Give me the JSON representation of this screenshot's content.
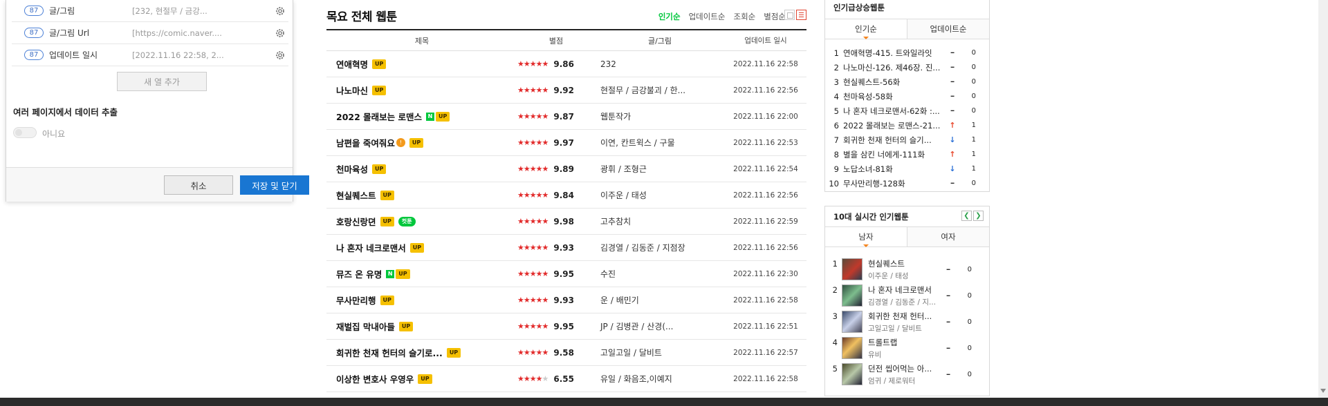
{
  "extract_panel": {
    "fields": [
      {
        "count": "87",
        "name": "글/그림",
        "sample": "[232, 현절무 / 금강..."
      },
      {
        "count": "87",
        "name": "글/그림 Url",
        "sample": "[https://comic.naver...."
      },
      {
        "count": "87",
        "name": "업데이트 일시",
        "sample": "[2022.11.16 22:58, 2..."
      }
    ],
    "add_column_label": "새 열 추가",
    "multi_page_title": "여러 페이지에서 데이터 추출",
    "multi_page_toggle_label": "아니요",
    "cancel_label": "취소",
    "save_label": "저장 및 닫기"
  },
  "webtoon_list": {
    "title": "목요 전체 웹툰",
    "sort_options": [
      "인기순",
      "업데이트순",
      "조회순",
      "별점순"
    ],
    "active_sort": "인기순",
    "headers": {
      "title": "제목",
      "rating": "별점",
      "author": "글/그림",
      "date": "업데이트 일시"
    },
    "rows": [
      {
        "title": "연애혁명",
        "badges": [
          "UP"
        ],
        "stars": 5,
        "rating": "9.86",
        "author": "232",
        "date": "2022.11.16 22:58"
      },
      {
        "title": "나노마신",
        "badges": [
          "UP"
        ],
        "stars": 5,
        "rating": "9.92",
        "author": "현절무 / 금강불괴 / 한...",
        "date": "2022.11.16 22:56"
      },
      {
        "title": "2022 몰래보는 로맨스",
        "badges": [
          "N",
          "UP"
        ],
        "stars": 5,
        "rating": "9.87",
        "author": "웹툰작가",
        "date": "2022.11.16 22:00"
      },
      {
        "title": "남편을 죽여줘요",
        "badges": [
          "AGE",
          "UP"
        ],
        "stars": 5,
        "rating": "9.97",
        "author": "이연, 칸트윅스 / 구물",
        "date": "2022.11.16 22:53"
      },
      {
        "title": "천마육성",
        "badges": [
          "UP"
        ],
        "stars": 5,
        "rating": "9.89",
        "author": "광휘 / 조형근",
        "date": "2022.11.16 22:54"
      },
      {
        "title": "현실퀘스트",
        "badges": [
          "UP"
        ],
        "stars": 5,
        "rating": "9.84",
        "author": "이주운 / 태성",
        "date": "2022.11.16 22:56"
      },
      {
        "title": "호랑신랑뎐",
        "badges": [
          "UP",
          "컷툰"
        ],
        "stars": 5,
        "rating": "9.98",
        "author": "고추참치",
        "date": "2022.11.16 22:59"
      },
      {
        "title": "나 혼자 네크로맨서",
        "badges": [
          "UP"
        ],
        "stars": 5,
        "rating": "9.93",
        "author": "김경열 / 김동준 / 지점장",
        "date": "2022.11.16 22:56"
      },
      {
        "title": "뮤즈 온 유명",
        "badges": [
          "N",
          "UP"
        ],
        "stars": 5,
        "rating": "9.95",
        "author": "수진",
        "date": "2022.11.16 22:30"
      },
      {
        "title": "무사만리행",
        "badges": [
          "UP"
        ],
        "stars": 5,
        "rating": "9.93",
        "author": "운 / 배민기",
        "date": "2022.11.16 22:58"
      },
      {
        "title": "재벌집 막내아들",
        "badges": [
          "UP"
        ],
        "stars": 5,
        "rating": "9.95",
        "author": "JP / 김병관 / 산경(...",
        "date": "2022.11.16 22:51"
      },
      {
        "title": "회귀한 천재 헌터의 슬기로...",
        "badges": [
          "UP"
        ],
        "stars": 5,
        "rating": "9.58",
        "author": "고일고일 / 달비트",
        "date": "2022.11.16 22:57"
      },
      {
        "title": "이상한 변호사 우영우",
        "badges": [
          "UP"
        ],
        "stars": 3.5,
        "rating": "6.55",
        "author": "유일 / 화음조,이예지",
        "date": "2022.11.16 22:58"
      }
    ]
  },
  "rising_widget": {
    "title": "인기급상승웹툰",
    "tabs": [
      "인기순",
      "업데이트순"
    ],
    "active_tab": "인기순",
    "items": [
      {
        "rank": "1",
        "title": "연애혁명-415. 트와일라잇",
        "trend": "same",
        "count": "0"
      },
      {
        "rank": "2",
        "title": "나노마신-126. 제46장. 진...",
        "trend": "same",
        "count": "0"
      },
      {
        "rank": "3",
        "title": "현실퀘스트-56화",
        "trend": "same",
        "count": "0"
      },
      {
        "rank": "4",
        "title": "천마육성-58화",
        "trend": "same",
        "count": "0"
      },
      {
        "rank": "5",
        "title": "나 혼자 네크로맨서-62화 :...",
        "trend": "same",
        "count": "0"
      },
      {
        "rank": "6",
        "title": "2022 몰래보는 로맨스-21...",
        "trend": "up",
        "count": "1"
      },
      {
        "rank": "7",
        "title": "회귀한 천재 헌터의 슬기...",
        "trend": "down",
        "count": "1"
      },
      {
        "rank": "8",
        "title": "별을 삼킨 너에게-111화",
        "trend": "up",
        "count": "1"
      },
      {
        "rank": "9",
        "title": "노답소녀-81화",
        "trend": "down",
        "count": "1"
      },
      {
        "rank": "10",
        "title": "무사만리행-128화",
        "trend": "same",
        "count": "0"
      }
    ]
  },
  "realtime_widget": {
    "title": "10대 실시간 인기웹툰",
    "tabs": [
      "남자",
      "여자"
    ],
    "active_tab": "남자",
    "items": [
      {
        "rank": "1",
        "title": "현실퀘스트",
        "author": "이주운 / 태성",
        "trend": "same",
        "count": "0"
      },
      {
        "rank": "2",
        "title": "나 혼자 네크로맨서",
        "author": "김경열 / 김동준 / 지...",
        "trend": "same",
        "count": "0"
      },
      {
        "rank": "3",
        "title": "회귀한 천재 헌터...",
        "author": "고일고일 / 달비트",
        "trend": "same",
        "count": "0"
      },
      {
        "rank": "4",
        "title": "트롤트랩",
        "author": "유비",
        "trend": "same",
        "count": "0"
      },
      {
        "rank": "5",
        "title": "던전 씹어먹는 아...",
        "author": "엄귀 / 제로워터",
        "trend": "same",
        "count": "0"
      }
    ]
  },
  "icons": {
    "field_settings": "gear-icon",
    "sort_up": "arrow-up-icon",
    "sort_down": "arrow-down-icon",
    "same": "dash-icon"
  },
  "colors": {
    "accent_green": "#00c73c",
    "save_button": "#1976d2",
    "star_red": "#e22b2b",
    "up_badge": "#f5c000",
    "trend_up": "#e8472b",
    "trend_down": "#2a6fd6"
  }
}
